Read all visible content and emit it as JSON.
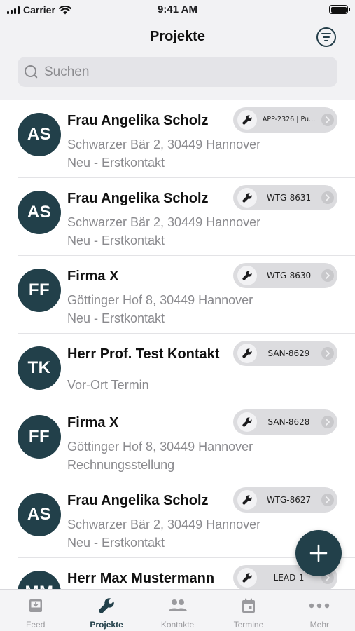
{
  "status_bar": {
    "carrier": "Carrier",
    "time": "9:41 AM"
  },
  "header": {
    "title": "Projekte"
  },
  "search": {
    "placeholder": "Suchen"
  },
  "projects": [
    {
      "initials": "AS",
      "name": "Frau Angelika Scholz",
      "address": "Schwarzer Bär 2, 30449 Hannover",
      "status": "Neu - Erstkontakt",
      "code": "APP-2326 | Pu..."
    },
    {
      "initials": "AS",
      "name": "Frau Angelika Scholz",
      "address": "Schwarzer Bär 2, 30449 Hannover",
      "status": "Neu - Erstkontakt",
      "code": "WTG-8631"
    },
    {
      "initials": "FF",
      "name": "Firma X",
      "address": "Göttinger Hof 8, 30449 Hannover",
      "status": "Neu - Erstkontakt",
      "code": "WTG-8630"
    },
    {
      "initials": "TK",
      "name": "Herr Prof. Test Kontakt",
      "address": "",
      "status": "Vor-Ort Termin",
      "code": "SAN-8629"
    },
    {
      "initials": "FF",
      "name": "Firma X",
      "address": "Göttinger Hof 8, 30449 Hannover",
      "status": "Rechnungsstellung",
      "code": "SAN-8628"
    },
    {
      "initials": "AS",
      "name": "Frau Angelika Scholz",
      "address": "Schwarzer Bär 2, 30449 Hannover",
      "status": "Neu - Erstkontakt",
      "code": "WTG-8627"
    },
    {
      "initials": "MM",
      "name": "Herr Max Mustermann",
      "address": "",
      "status": "",
      "code": "LEAD-1"
    }
  ],
  "tabs": [
    {
      "label": "Feed",
      "icon": "feed-inbox-icon",
      "active": false
    },
    {
      "label": "Projekte",
      "icon": "wrench-icon",
      "active": true
    },
    {
      "label": "Kontakte",
      "icon": "people-icon",
      "active": false
    },
    {
      "label": "Termine",
      "icon": "calendar-icon",
      "active": false
    },
    {
      "label": "Mehr",
      "icon": "more-dots-icon",
      "active": false
    }
  ],
  "colors": {
    "accent": "#22404a",
    "header_bg": "#f2f2f4",
    "secondary_text": "#8a8a8e",
    "badge_bg": "#dcdcdf"
  }
}
